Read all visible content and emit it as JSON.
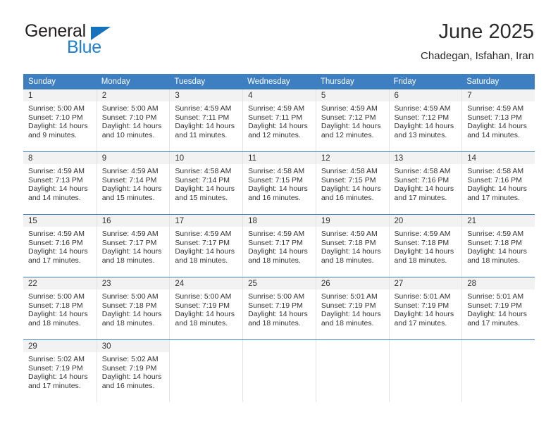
{
  "brand": {
    "word_top": "General",
    "word_bottom": "Blue",
    "triangle_color": "#1573be",
    "blue_color": "#1f7fd0"
  },
  "header": {
    "title": "June 2025",
    "subtitle": "Chadegan, Isfahan, Iran"
  },
  "theme": {
    "header_blue": "#3d7fc1",
    "daynum_strip": "#f2f2f2",
    "cell_divider": "#e3e3e3"
  },
  "calendar": {
    "weekday_headers": [
      "Sunday",
      "Monday",
      "Tuesday",
      "Wednesday",
      "Thursday",
      "Friday",
      "Saturday"
    ],
    "weeks": [
      [
        {
          "day": "1",
          "sunrise": "Sunrise: 5:00 AM",
          "sunset": "Sunset: 7:10 PM",
          "daylight1": "Daylight: 14 hours",
          "daylight2": "and 9 minutes."
        },
        {
          "day": "2",
          "sunrise": "Sunrise: 5:00 AM",
          "sunset": "Sunset: 7:10 PM",
          "daylight1": "Daylight: 14 hours",
          "daylight2": "and 10 minutes."
        },
        {
          "day": "3",
          "sunrise": "Sunrise: 4:59 AM",
          "sunset": "Sunset: 7:11 PM",
          "daylight1": "Daylight: 14 hours",
          "daylight2": "and 11 minutes."
        },
        {
          "day": "4",
          "sunrise": "Sunrise: 4:59 AM",
          "sunset": "Sunset: 7:11 PM",
          "daylight1": "Daylight: 14 hours",
          "daylight2": "and 12 minutes."
        },
        {
          "day": "5",
          "sunrise": "Sunrise: 4:59 AM",
          "sunset": "Sunset: 7:12 PM",
          "daylight1": "Daylight: 14 hours",
          "daylight2": "and 12 minutes."
        },
        {
          "day": "6",
          "sunrise": "Sunrise: 4:59 AM",
          "sunset": "Sunset: 7:12 PM",
          "daylight1": "Daylight: 14 hours",
          "daylight2": "and 13 minutes."
        },
        {
          "day": "7",
          "sunrise": "Sunrise: 4:59 AM",
          "sunset": "Sunset: 7:13 PM",
          "daylight1": "Daylight: 14 hours",
          "daylight2": "and 14 minutes."
        }
      ],
      [
        {
          "day": "8",
          "sunrise": "Sunrise: 4:59 AM",
          "sunset": "Sunset: 7:13 PM",
          "daylight1": "Daylight: 14 hours",
          "daylight2": "and 14 minutes."
        },
        {
          "day": "9",
          "sunrise": "Sunrise: 4:59 AM",
          "sunset": "Sunset: 7:14 PM",
          "daylight1": "Daylight: 14 hours",
          "daylight2": "and 15 minutes."
        },
        {
          "day": "10",
          "sunrise": "Sunrise: 4:58 AM",
          "sunset": "Sunset: 7:14 PM",
          "daylight1": "Daylight: 14 hours",
          "daylight2": "and 15 minutes."
        },
        {
          "day": "11",
          "sunrise": "Sunrise: 4:58 AM",
          "sunset": "Sunset: 7:15 PM",
          "daylight1": "Daylight: 14 hours",
          "daylight2": "and 16 minutes."
        },
        {
          "day": "12",
          "sunrise": "Sunrise: 4:58 AM",
          "sunset": "Sunset: 7:15 PM",
          "daylight1": "Daylight: 14 hours",
          "daylight2": "and 16 minutes."
        },
        {
          "day": "13",
          "sunrise": "Sunrise: 4:58 AM",
          "sunset": "Sunset: 7:16 PM",
          "daylight1": "Daylight: 14 hours",
          "daylight2": "and 17 minutes."
        },
        {
          "day": "14",
          "sunrise": "Sunrise: 4:58 AM",
          "sunset": "Sunset: 7:16 PM",
          "daylight1": "Daylight: 14 hours",
          "daylight2": "and 17 minutes."
        }
      ],
      [
        {
          "day": "15",
          "sunrise": "Sunrise: 4:59 AM",
          "sunset": "Sunset: 7:16 PM",
          "daylight1": "Daylight: 14 hours",
          "daylight2": "and 17 minutes."
        },
        {
          "day": "16",
          "sunrise": "Sunrise: 4:59 AM",
          "sunset": "Sunset: 7:17 PM",
          "daylight1": "Daylight: 14 hours",
          "daylight2": "and 18 minutes."
        },
        {
          "day": "17",
          "sunrise": "Sunrise: 4:59 AM",
          "sunset": "Sunset: 7:17 PM",
          "daylight1": "Daylight: 14 hours",
          "daylight2": "and 18 minutes."
        },
        {
          "day": "18",
          "sunrise": "Sunrise: 4:59 AM",
          "sunset": "Sunset: 7:17 PM",
          "daylight1": "Daylight: 14 hours",
          "daylight2": "and 18 minutes."
        },
        {
          "day": "19",
          "sunrise": "Sunrise: 4:59 AM",
          "sunset": "Sunset: 7:18 PM",
          "daylight1": "Daylight: 14 hours",
          "daylight2": "and 18 minutes."
        },
        {
          "day": "20",
          "sunrise": "Sunrise: 4:59 AM",
          "sunset": "Sunset: 7:18 PM",
          "daylight1": "Daylight: 14 hours",
          "daylight2": "and 18 minutes."
        },
        {
          "day": "21",
          "sunrise": "Sunrise: 4:59 AM",
          "sunset": "Sunset: 7:18 PM",
          "daylight1": "Daylight: 14 hours",
          "daylight2": "and 18 minutes."
        }
      ],
      [
        {
          "day": "22",
          "sunrise": "Sunrise: 5:00 AM",
          "sunset": "Sunset: 7:18 PM",
          "daylight1": "Daylight: 14 hours",
          "daylight2": "and 18 minutes."
        },
        {
          "day": "23",
          "sunrise": "Sunrise: 5:00 AM",
          "sunset": "Sunset: 7:18 PM",
          "daylight1": "Daylight: 14 hours",
          "daylight2": "and 18 minutes."
        },
        {
          "day": "24",
          "sunrise": "Sunrise: 5:00 AM",
          "sunset": "Sunset: 7:19 PM",
          "daylight1": "Daylight: 14 hours",
          "daylight2": "and 18 minutes."
        },
        {
          "day": "25",
          "sunrise": "Sunrise: 5:00 AM",
          "sunset": "Sunset: 7:19 PM",
          "daylight1": "Daylight: 14 hours",
          "daylight2": "and 18 minutes."
        },
        {
          "day": "26",
          "sunrise": "Sunrise: 5:01 AM",
          "sunset": "Sunset: 7:19 PM",
          "daylight1": "Daylight: 14 hours",
          "daylight2": "and 18 minutes."
        },
        {
          "day": "27",
          "sunrise": "Sunrise: 5:01 AM",
          "sunset": "Sunset: 7:19 PM",
          "daylight1": "Daylight: 14 hours",
          "daylight2": "and 17 minutes."
        },
        {
          "day": "28",
          "sunrise": "Sunrise: 5:01 AM",
          "sunset": "Sunset: 7:19 PM",
          "daylight1": "Daylight: 14 hours",
          "daylight2": "and 17 minutes."
        }
      ],
      [
        {
          "day": "29",
          "sunrise": "Sunrise: 5:02 AM",
          "sunset": "Sunset: 7:19 PM",
          "daylight1": "Daylight: 14 hours",
          "daylight2": "and 17 minutes."
        },
        {
          "day": "30",
          "sunrise": "Sunrise: 5:02 AM",
          "sunset": "Sunset: 7:19 PM",
          "daylight1": "Daylight: 14 hours",
          "daylight2": "and 16 minutes."
        },
        {
          "day": "",
          "sunrise": "",
          "sunset": "",
          "daylight1": "",
          "daylight2": ""
        },
        {
          "day": "",
          "sunrise": "",
          "sunset": "",
          "daylight1": "",
          "daylight2": ""
        },
        {
          "day": "",
          "sunrise": "",
          "sunset": "",
          "daylight1": "",
          "daylight2": ""
        },
        {
          "day": "",
          "sunrise": "",
          "sunset": "",
          "daylight1": "",
          "daylight2": ""
        },
        {
          "day": "",
          "sunrise": "",
          "sunset": "",
          "daylight1": "",
          "daylight2": ""
        }
      ]
    ]
  }
}
